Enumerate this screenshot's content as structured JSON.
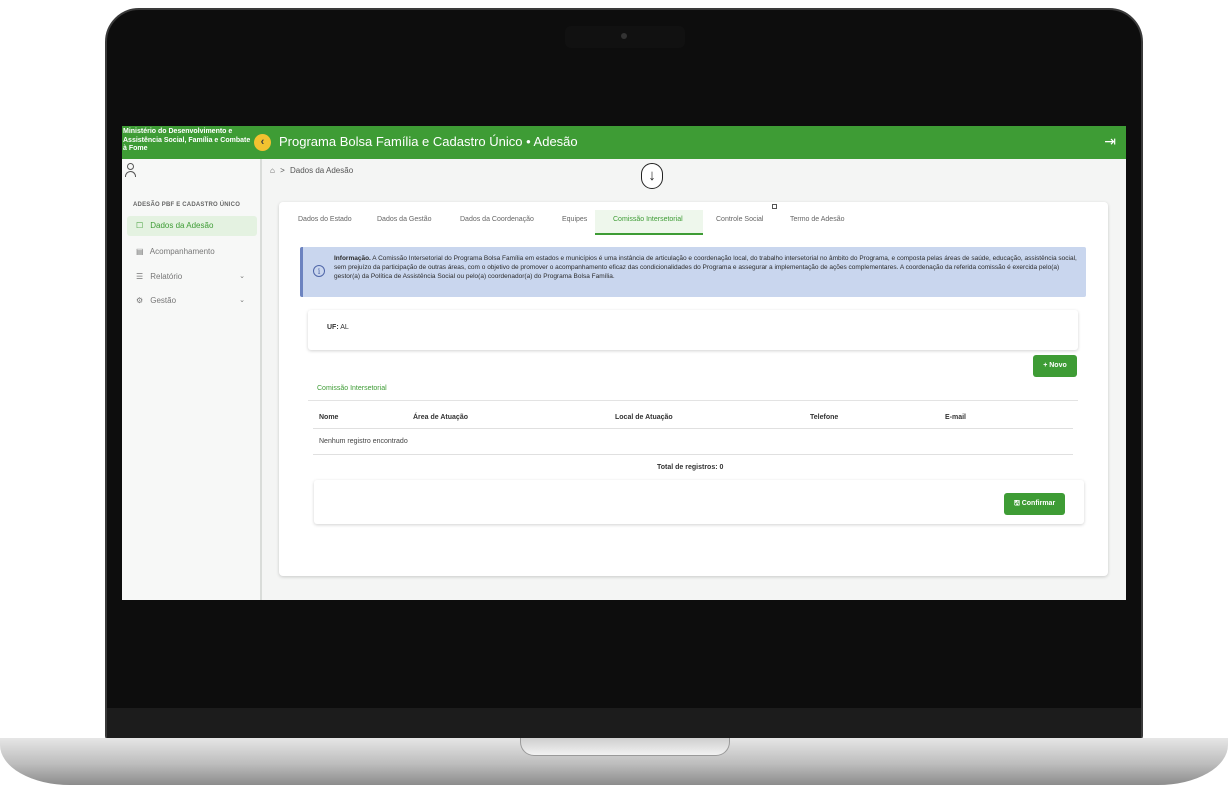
{
  "header": {
    "ministry": "Ministério do Desenvolvimento e Assistência Social, Família e Combate à Fome",
    "collapse_glyph": "‹",
    "title": "Programa Bolsa Família e Cadastro Único • Adesão",
    "logout_glyph": "⇥"
  },
  "sidebar": {
    "heading": "ADESÃO PBF E CADASTRO ÚNICO",
    "items": [
      {
        "label": "Dados da Adesão",
        "icon": "☐"
      },
      {
        "label": "Acompanhamento",
        "icon": "▤"
      },
      {
        "label": "Relatório",
        "icon": "☰",
        "chevron": "⌄"
      },
      {
        "label": "Gestão",
        "icon": "⚙",
        "chevron": "⌄"
      }
    ]
  },
  "breadcrumb": {
    "home_glyph": "⌂",
    "sep": ">",
    "current": "Dados da Adesão"
  },
  "overlay": {
    "arrow_glyph": "↓"
  },
  "tabs": [
    {
      "label": "Dados do Estado"
    },
    {
      "label": "Dados da Gestão"
    },
    {
      "label": "Dados da Coordenação"
    },
    {
      "label": "Equipes"
    },
    {
      "label": "Comissão Intersetorial"
    },
    {
      "label": "Controle Social"
    },
    {
      "label": "Termo de Adesão"
    }
  ],
  "info": {
    "icon_glyph": "i",
    "bold": "Informação.",
    "text": " A Comissão Intersetorial do Programa Bolsa Família em estados e municípios é uma instância de articulação e coordenação local, do trabalho intersetorial no âmbito do Programa, e composta pelas áreas de saúde, educação, assistência social, sem prejuízo da participação de outras áreas, com o objetivo de promover o acompanhamento eficaz das condicionalidades do Programa e assegurar a implementação de ações complementares. A coordenação da referida comissão é exercida pelo(a) gestor(a) da Política de Assistência Social ou pelo(a) coordenador(a) do Programa Bolsa Família."
  },
  "uf": {
    "label": "UF:",
    "value": "AL"
  },
  "novo_button": "+ Novo",
  "section_title": "Comissão Intersetorial",
  "table": {
    "headers": [
      "Nome",
      "Área de Atuação",
      "Local de Atuação",
      "Telefone",
      "E-mail"
    ],
    "empty": "Nenhum registro encontrado",
    "total": "Total de registros: 0"
  },
  "confirm_button": "🖫 Confirmar"
}
